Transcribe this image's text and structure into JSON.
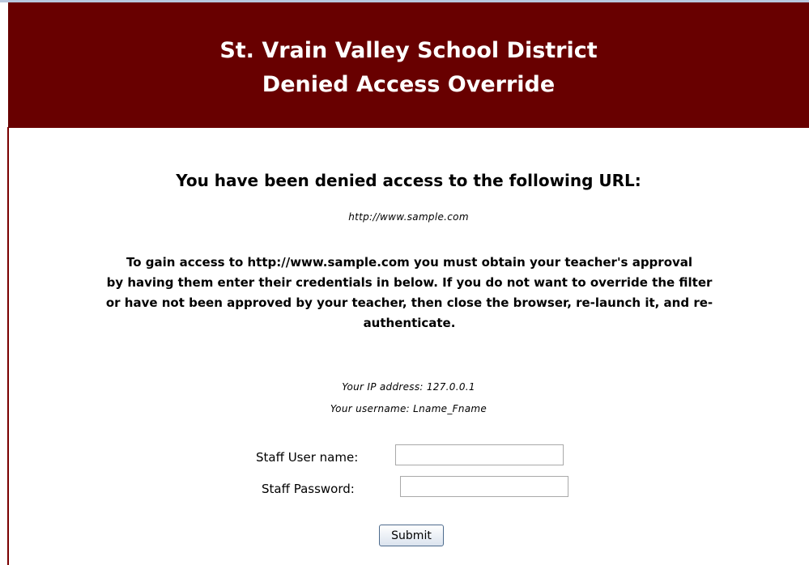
{
  "header": {
    "line1": "St. Vrain Valley School District",
    "line2": "Denied Access Override",
    "background": "#680000"
  },
  "denied": {
    "heading": "You have been denied access to the following URL:",
    "url": "http://www.sample.com"
  },
  "instructions": {
    "line1": "To gain access to http://www.sample.com you must obtain your teacher's approval",
    "line2": "by having them enter their credentials in below. If you do not want to override the filter",
    "line3": "or have not been approved by your teacher, then close the browser, re-launch it, and re-",
    "line4": "authenticate."
  },
  "info": {
    "ip": "Your IP address: 127.0.0.1",
    "username": "Your username: Lname_Fname"
  },
  "form": {
    "user_label": "Staff User name:",
    "user_value": "",
    "password_label": "Staff Password:",
    "password_value": "",
    "submit_label": "Submit"
  }
}
